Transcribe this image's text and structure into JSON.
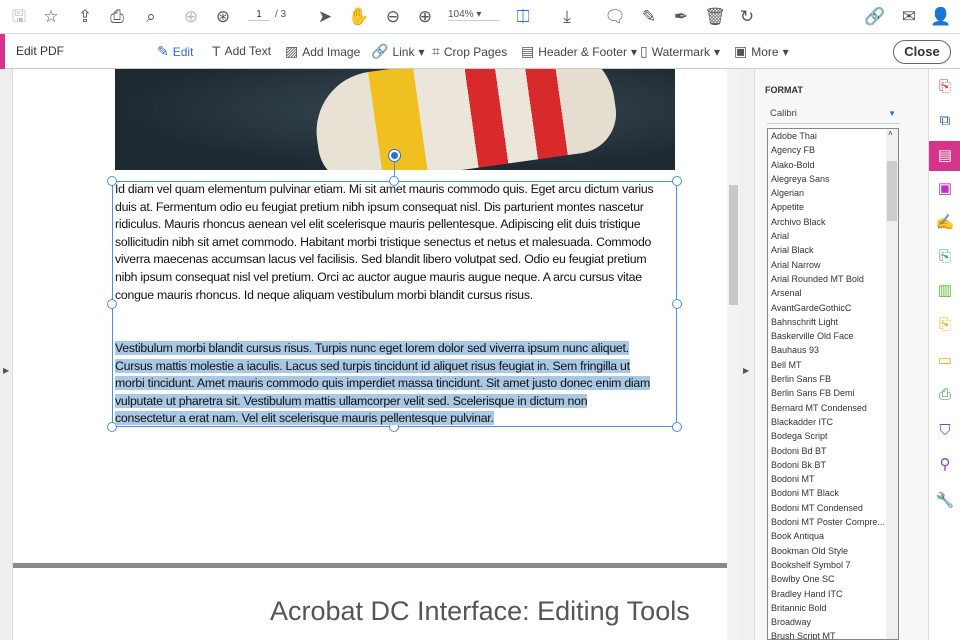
{
  "toolbar": {
    "page_current": "1",
    "page_total": "/ 3",
    "zoom": "104%"
  },
  "edit_bar": {
    "title": "Edit PDF",
    "edit": "Edit",
    "add_text": "Add Text",
    "add_image": "Add Image",
    "link": "Link",
    "crop": "Crop Pages",
    "header_footer": "Header & Footer",
    "watermark": "Watermark",
    "more": "More",
    "close": "Close"
  },
  "document": {
    "para1": [
      "Id diam vel quam elementum pulvinar etiam. Mi sit amet mauris commodo quis. Eget arcu dictum varius",
      "duis at. Fermentum odio eu feugiat pretium nibh ipsum consequat nisl. Dis parturient montes nascetur",
      "ridiculus. Mauris rhoncus aenean vel elit scelerisque mauris pellentesque. Adipiscing elit duis tristique",
      "sollicitudin nibh sit amet commodo. Habitant morbi tristique senectus et netus et malesuada. Commodo",
      "viverra maecenas accumsan lacus vel facilisis. Sed blandit libero volutpat sed. Odio eu feugiat pretium",
      "nibh ipsum consequat nisl vel pretium. Orci ac auctor augue mauris augue neque. A arcu cursus vitae",
      "congue mauris rhoncus. Id neque aliquam vestibulum morbi blandit cursus risus."
    ],
    "para2": [
      "Vestibulum morbi blandit cursus risus. Turpis nunc eget lorem dolor sed viverra ipsum nunc aliquet.",
      "Cursus mattis molestie a iaculis. Lacus sed turpis tincidunt id aliquet risus feugiat in. Sem fringilla ut",
      "morbi tincidunt. Amet mauris commodo quis imperdiet massa tincidunt. Sit amet justo donec enim diam",
      "vulputate ut pharetra sit. Vestibulum mattis ullamcorper velit sed. Scelerisque in dictum non",
      "consectetur a erat nam. Vel elit scelerisque mauris pellentesque pulvinar."
    ],
    "next_page_title": "Acrobat DC Interface: Editing Tools"
  },
  "format_panel": {
    "heading": "FORMAT",
    "font_selected": "Calibri",
    "font_options": [
      "Adobe Thai",
      "Agency FB",
      "Alako-Bold",
      "Alegreya Sans",
      "Algerian",
      "Appetite",
      "Archivo Black",
      "Arial",
      "Arial Black",
      "Arial Narrow",
      "Arial Rounded MT Bold",
      "Arsenal",
      "AvantGardeGothicC",
      "Bahnschrift Light",
      "Baskerville Old Face",
      "Bauhaus 93",
      "Bell MT",
      "Berlin Sans FB",
      "Berlin Sans FB Demi",
      "Bernard MT Condensed",
      "Blackadder ITC",
      "Bodega Script",
      "Bodoni Bd BT",
      "Bodoni Bk BT",
      "Bodoni MT",
      "Bodoni MT Black",
      "Bodoni MT Condensed",
      "Bodoni MT Poster Compre...",
      "Book Antiqua",
      "Bookman Old Style",
      "Bookshelf Symbol 7",
      "Bowlby One SC",
      "Bradley Hand ITC",
      "Britannic Bold",
      "Broadway",
      "Brush Script MT"
    ]
  },
  "colors": {
    "accent": "#d6338a",
    "selection": "#a8c8e4",
    "link_blue": "#2d6fcf"
  }
}
